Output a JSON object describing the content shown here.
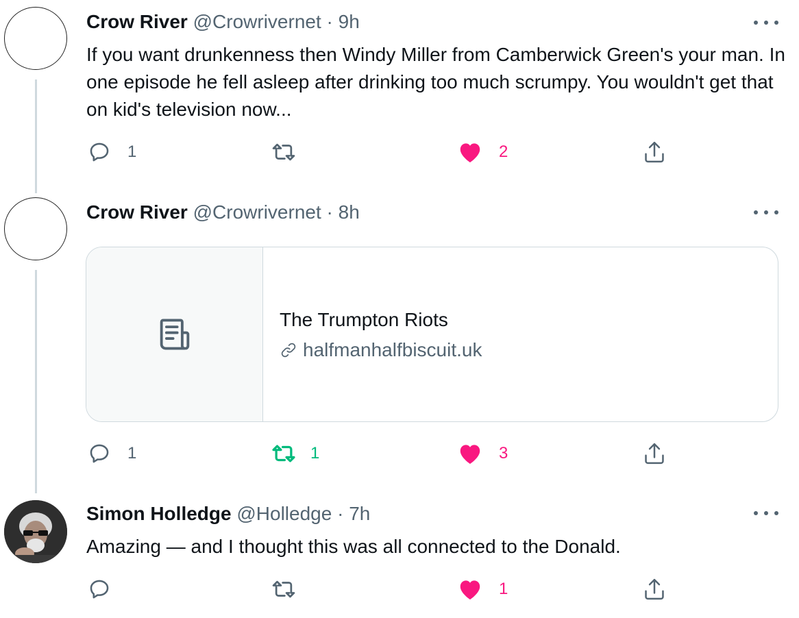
{
  "tweets": [
    {
      "name": "Crow River",
      "handle": "@Crowrivernet",
      "separator": "·",
      "time": "9h",
      "text": "If you want drunkenness then Windy Miller from Camberwick Green's your man. In one episode he fell asleep after drinking too much scrumpy. You wouldn't get that on kid's television now...",
      "reply_count": "1",
      "retweet_count": "",
      "like_count": "2",
      "liked": true,
      "retweeted": false
    },
    {
      "name": "Crow River",
      "handle": "@Crowrivernet",
      "separator": "·",
      "time": "8h",
      "card": {
        "title": "The Trumpton Riots",
        "domain": "halfmanhalfbiscuit.uk",
        "thumb_icon": "article-icon"
      },
      "reply_count": "1",
      "retweet_count": "1",
      "like_count": "3",
      "liked": true,
      "retweeted": true
    },
    {
      "name": "Simon Holledge",
      "handle": "@Holledge",
      "separator": "·",
      "time": "7h",
      "text": "Amazing — and I thought this was all connected to the Donald.",
      "reply_count": "",
      "retweet_count": "",
      "like_count": "1",
      "liked": true,
      "retweeted": false
    }
  ],
  "colors": {
    "text_primary": "#0f1419",
    "text_secondary": "#536471",
    "like": "#f91880",
    "retweet": "#00ba7c",
    "border": "#cfd9de"
  },
  "icons": {
    "reply": "reply-icon",
    "retweet": "retweet-icon",
    "like": "heart-icon",
    "share": "share-icon",
    "more": "more-icon",
    "link": "link-icon"
  }
}
